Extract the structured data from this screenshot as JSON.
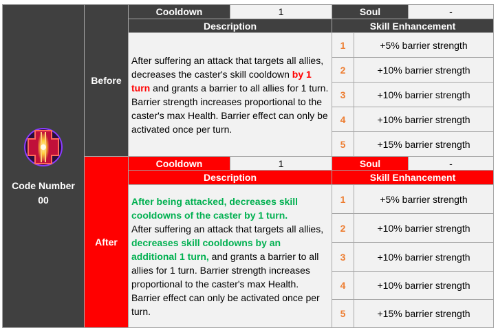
{
  "character": {
    "name_line1": "Code Number",
    "name_line2": "00",
    "icon": "hexagon-core-icon",
    "colors": {
      "core": "#c0103a",
      "glow": "#ffcc33",
      "frame": "#8a3cff"
    }
  },
  "colors": {
    "dark_header": "#404040",
    "after_red": "#ff0000",
    "cell_bg": "#f2f2f2",
    "level_orange": "#ed7d31",
    "highlight_red": "#ff0000",
    "highlight_green": "#00b050"
  },
  "before": {
    "label": "Before",
    "cooldown_label": "Cooldown",
    "cooldown_value": "1",
    "soul_label": "Soul",
    "soul_value": "-",
    "description_header": "Description",
    "enhancement_header": "Skill Enhancement",
    "description": {
      "part1": "After suffering an attack that targets all allies, decreases the caster's skill cooldown ",
      "highlight": "by 1 turn",
      "part2": " and grants a barrier to all allies for 1 turn. Barrier strength increases proportional to the caster's max Health. Barrier effect can only be activated once per turn."
    },
    "enhancements": [
      {
        "level": "1",
        "text": "+5% barrier strength"
      },
      {
        "level": "2",
        "text": "+10% barrier strength"
      },
      {
        "level": "3",
        "text": "+10% barrier strength"
      },
      {
        "level": "4",
        "text": "+10% barrier strength"
      },
      {
        "level": "5",
        "text": "+15% barrier strength"
      }
    ]
  },
  "after": {
    "label": "After",
    "cooldown_label": "Cooldown",
    "cooldown_value": "1",
    "soul_label": "Soul",
    "soul_value": "-",
    "description_header": "Description",
    "enhancement_header": "Skill Enhancement",
    "description": {
      "highlight1": "After being attacked, decreases skill cooldowns of the caster by 1 turn.",
      "part1": " After suffering an attack that targets all allies, ",
      "highlight2": "decreases skill cooldowns by an additional 1 turn,",
      "part2": " and grants a barrier to all allies for 1 turn. Barrier strength increases proportional to the caster's max Health. Barrier effect can only be activated once per turn."
    },
    "enhancements": [
      {
        "level": "1",
        "text": "+5% barrier strength"
      },
      {
        "level": "2",
        "text": "+10% barrier strength"
      },
      {
        "level": "3",
        "text": "+10% barrier strength"
      },
      {
        "level": "4",
        "text": "+10% barrier strength"
      },
      {
        "level": "5",
        "text": "+15% barrier strength"
      }
    ]
  }
}
